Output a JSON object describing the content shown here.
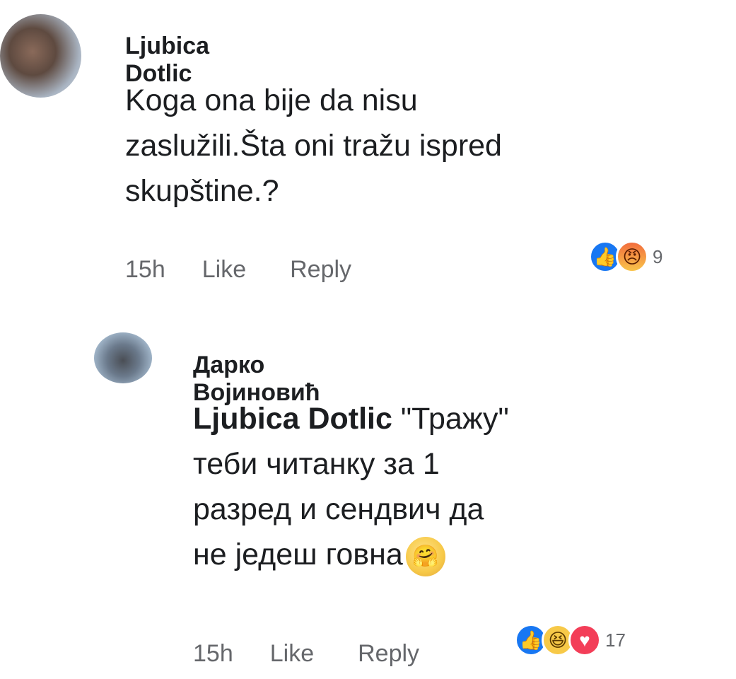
{
  "comments": [
    {
      "author": "Ljubica Dotlic",
      "avatar_icon": "profile-photo-icon",
      "text_lines": [
        "Koga ona bije da nisu",
        "zaslužili.Šta oni tražu ispred",
        "skupštine.?"
      ],
      "time": "15h",
      "like_label": "Like",
      "reply_label": "Reply",
      "reactions": [
        "like",
        "angry"
      ],
      "reaction_count": "9"
    },
    {
      "author": "Дарко Војиновић",
      "avatar_icon": "profile-photo-icon",
      "mention": "Ljubica Dotlic",
      "text_first_line_rest": " \"Тражу\"",
      "text_lines": [
        "теби читанку за 1",
        "разред и сендвич да",
        "не једеш говна"
      ],
      "trailing_emoji": "hugging-face-emoji",
      "time": "15h",
      "like_label": "Like",
      "reply_label": "Reply",
      "reactions": [
        "like",
        "haha",
        "love"
      ],
      "reaction_count": "17"
    }
  ],
  "colors": {
    "like_blue": "#1877f2",
    "love_red": "#f33e58",
    "meta_gray": "#65676b",
    "text": "#1c1e21"
  }
}
